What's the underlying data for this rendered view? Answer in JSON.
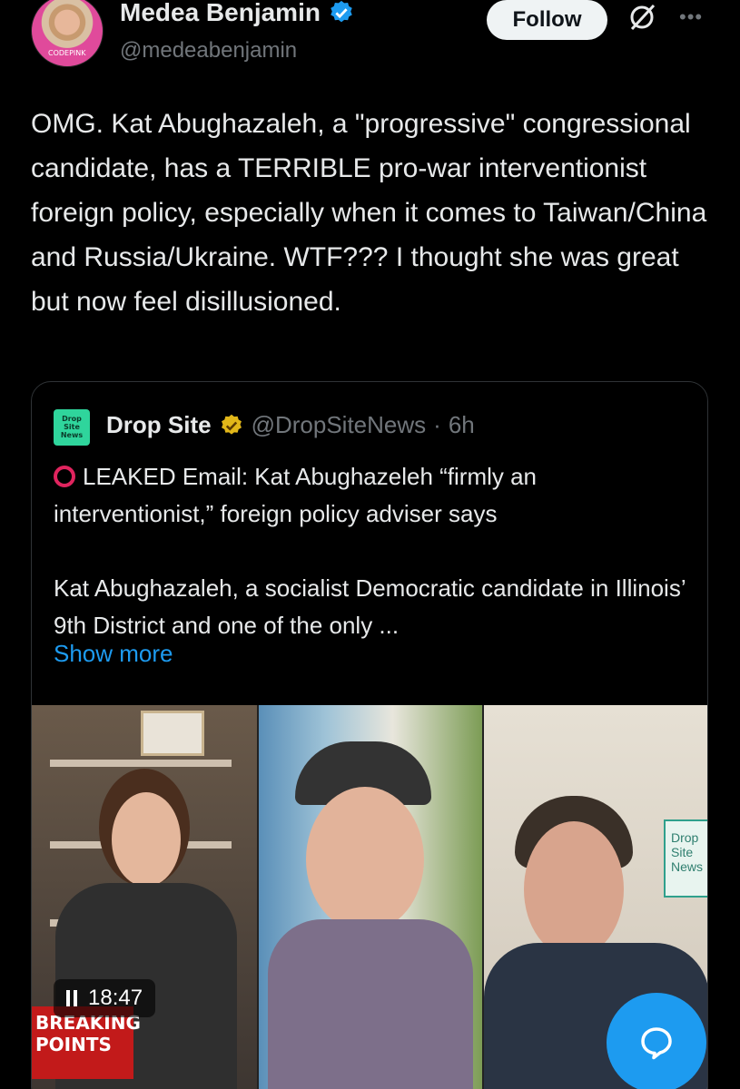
{
  "post": {
    "author_name": "Medea Benjamin",
    "author_handle": "@medeabenjamin",
    "avatar_text": "CODEPINK",
    "follow_label": "Follow",
    "more_label": "•••",
    "text": "OMG. Kat Abughazaleh, a \"progressive\" congressional candidate, has a TERRIBLE pro-war interventionist foreign policy, especially when it comes to Taiwan/China and Russia/Ukraine. WTF??? I thought she was great but now feel disillusioned."
  },
  "quote": {
    "avatar_text": "Drop Site News",
    "name": "Drop Site",
    "handle": "@DropSiteNews",
    "separator": "·",
    "time": "6h",
    "headline": "LEAKED Email: Kat Abughazeleh “firmly an interventionist,” foreign policy adviser says",
    "body": "Kat Abughazaleh, a socialist Democratic candidate in Illinois’ 9th District and one of the only ...",
    "show_more": "Show more"
  },
  "video": {
    "logo_text": "Drop Site News",
    "breaking_label": "BREAKING POINTS",
    "duration": "18:47"
  },
  "colors": {
    "accent": "#1d9bf0",
    "background": "#000000",
    "muted": "#71767b",
    "verified_gold": "#e2b719"
  },
  "icons": [
    "verified-badge-icon",
    "grok-icon",
    "more-icon",
    "pause-icon",
    "compose-message-icon",
    "red-circle-icon"
  ]
}
